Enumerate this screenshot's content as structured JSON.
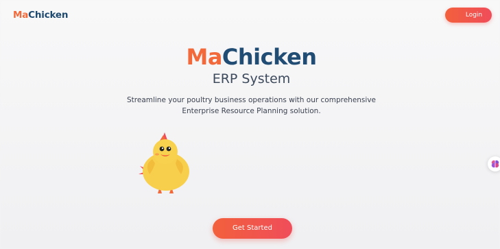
{
  "header": {
    "logo_part1": "Ma",
    "logo_part2": "Chicken",
    "login_label": "Login"
  },
  "hero": {
    "title_part1": "Ma",
    "title_part2": "Chicken",
    "subtitle": "ERP System",
    "description_line1": "Streamline your poultry business operations with our comprehensive",
    "description_line2": "Enterprise Resource Planning solution.",
    "cta_label": "Get Started"
  },
  "icons": {
    "mascot": "chicken-mascot-icon",
    "side": "brain-icon"
  },
  "colors": {
    "accent_orange": "#f26a3b",
    "brand_navy": "#214c73",
    "button_gradient_start": "#f2603c",
    "button_gradient_end": "#f04d5a",
    "chicken_body": "#f8cf4d"
  }
}
